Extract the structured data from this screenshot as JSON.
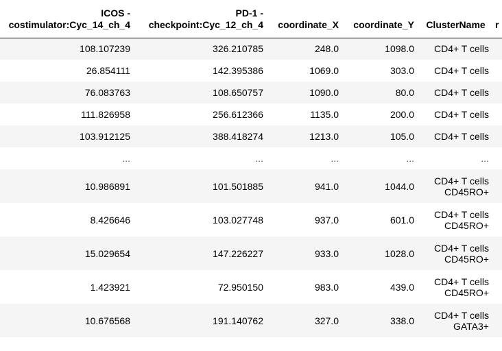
{
  "table": {
    "headers": [
      {
        "line1": "ICOS -",
        "line2": "costimulator:Cyc_14_ch_4"
      },
      {
        "line1": "PD-1 -",
        "line2": "checkpoint:Cyc_12_ch_4"
      },
      {
        "line1": "",
        "line2": "coordinate_X"
      },
      {
        "line1": "",
        "line2": "coordinate_Y"
      },
      {
        "line1": "",
        "line2": "ClusterName"
      },
      {
        "line1": "",
        "line2": "r"
      }
    ],
    "rows": [
      {
        "icos": "108.107239",
        "pd1": "326.210785",
        "x": "248.0",
        "y": "1098.0",
        "cluster": [
          "CD4+ T cells"
        ]
      },
      {
        "icos": "26.854111",
        "pd1": "142.395386",
        "x": "1069.0",
        "y": "303.0",
        "cluster": [
          "CD4+ T cells"
        ]
      },
      {
        "icos": "76.083763",
        "pd1": "108.650757",
        "x": "1090.0",
        "y": "80.0",
        "cluster": [
          "CD4+ T cells"
        ]
      },
      {
        "icos": "111.826958",
        "pd1": "256.612366",
        "x": "1135.0",
        "y": "200.0",
        "cluster": [
          "CD4+ T cells"
        ]
      },
      {
        "icos": "103.912125",
        "pd1": "388.418274",
        "x": "1213.0",
        "y": "105.0",
        "cluster": [
          "CD4+ T cells"
        ]
      },
      {
        "icos": "...",
        "pd1": "...",
        "x": "...",
        "y": "...",
        "cluster": [
          "..."
        ]
      },
      {
        "icos": "10.986891",
        "pd1": "101.501885",
        "x": "941.0",
        "y": "1044.0",
        "cluster": [
          "CD4+ T cells",
          "CD45RO+"
        ]
      },
      {
        "icos": "8.426646",
        "pd1": "103.027748",
        "x": "937.0",
        "y": "601.0",
        "cluster": [
          "CD4+ T cells",
          "CD45RO+"
        ]
      },
      {
        "icos": "15.029654",
        "pd1": "147.226227",
        "x": "933.0",
        "y": "1028.0",
        "cluster": [
          "CD4+ T cells",
          "CD45RO+"
        ]
      },
      {
        "icos": "1.423921",
        "pd1": "72.950150",
        "x": "983.0",
        "y": "439.0",
        "cluster": [
          "CD4+ T cells",
          "CD45RO+"
        ]
      },
      {
        "icos": "10.676568",
        "pd1": "191.140762",
        "x": "327.0",
        "y": "338.0",
        "cluster": [
          "CD4+ T cells",
          "GATA3+"
        ]
      }
    ]
  }
}
